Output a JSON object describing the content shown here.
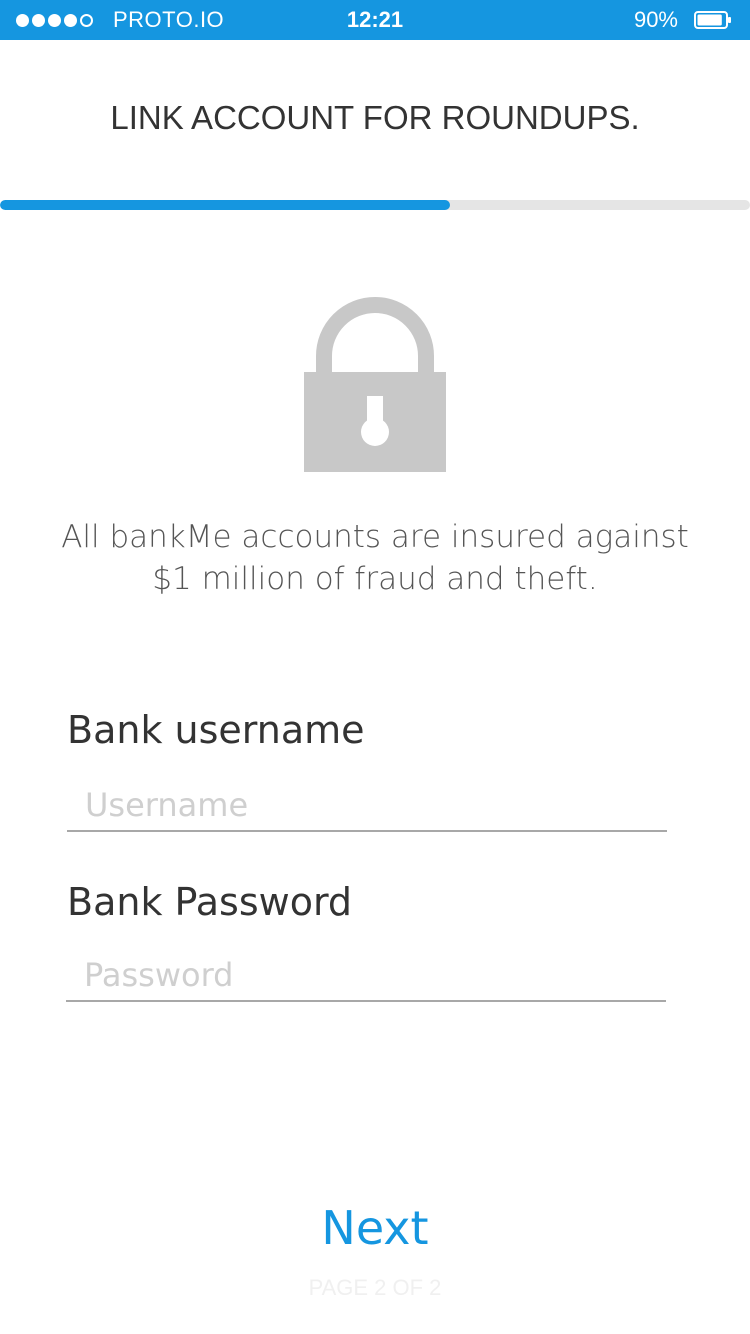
{
  "status_bar": {
    "carrier": "PROTO.IO",
    "time": "12:21",
    "battery_percent": "90%",
    "battery_level": 0.9,
    "signal_filled": 4,
    "signal_total": 5
  },
  "header": {
    "title": "LINK ACCOUNT FOR ROUNDUPS."
  },
  "progress": {
    "fraction": 0.6
  },
  "security": {
    "icon": "lock-icon",
    "message": "All bankMe accounts are insured against $1 million of fraud and theft."
  },
  "form": {
    "username": {
      "label": "Bank username",
      "placeholder": "Username",
      "value": ""
    },
    "password": {
      "label": "Bank Password",
      "placeholder": "Password",
      "value": ""
    }
  },
  "footer": {
    "next_label": "Next",
    "page_indicator": "PAGE 2 OF 2"
  },
  "colors": {
    "accent": "#1596e0",
    "lock_gray": "#c8c8c8",
    "track_gray": "#e5e5e5"
  }
}
